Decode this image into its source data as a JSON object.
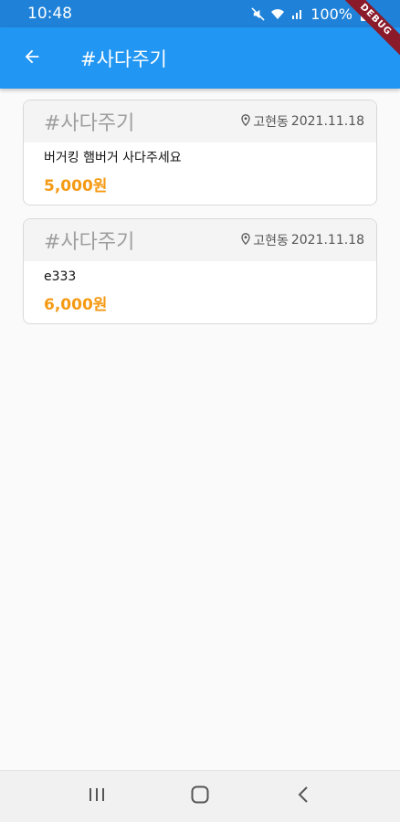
{
  "status_bar": {
    "time": "10:48",
    "battery": "100%",
    "icons": [
      "mute-icon",
      "wifi-icon",
      "signal-icon",
      "battery-icon"
    ]
  },
  "debug_banner": "DEBUG",
  "app_bar": {
    "back_icon": "arrow-left-icon",
    "title": "#사다주기"
  },
  "posts": [
    {
      "category": "#사다주기",
      "location": "고현동",
      "date": "2021.11.18",
      "text": "버거킹 햄버거 사다주세요",
      "price": "5,000원"
    },
    {
      "category": "#사다주기",
      "location": "고현동",
      "date": "2021.11.18",
      "text": "e333",
      "price": "6,000원"
    }
  ],
  "nav_bar": {
    "buttons": [
      "recents-icon",
      "home-icon",
      "back-icon"
    ]
  },
  "colors": {
    "app_bar": "#2196f3",
    "status_bar": "#1f82d8",
    "price": "#f59a14",
    "background": "#fafafa"
  }
}
